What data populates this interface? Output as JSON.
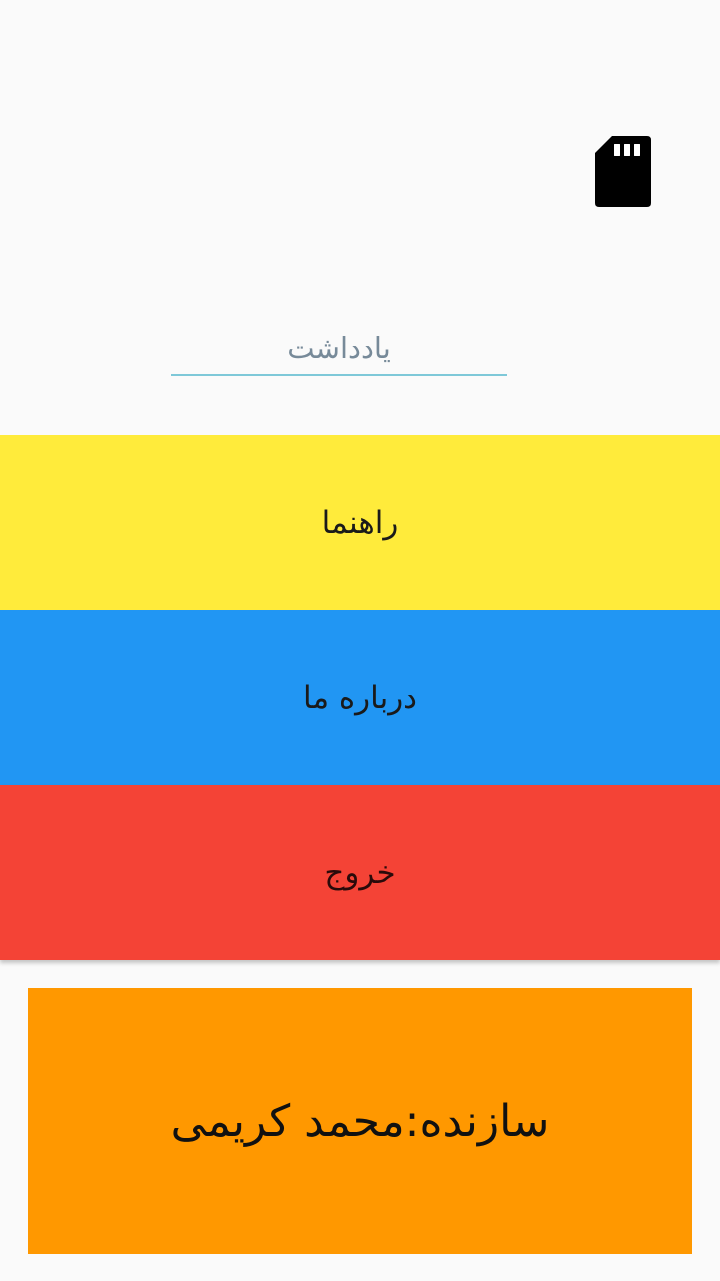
{
  "header": {
    "icon": "sd-card-icon"
  },
  "note_field": {
    "label": "یادداشت"
  },
  "menu": {
    "help_label": "راهنما",
    "about_label": "درباره ما",
    "exit_label": "خروج"
  },
  "creator": {
    "text": "سازنده:محمد کریمی"
  },
  "colors": {
    "background": "#fafafa",
    "help": "#ffeb3b",
    "about": "#2196f3",
    "exit": "#f44336",
    "creator": "#ff9800",
    "underline": "#7ec8d8"
  }
}
